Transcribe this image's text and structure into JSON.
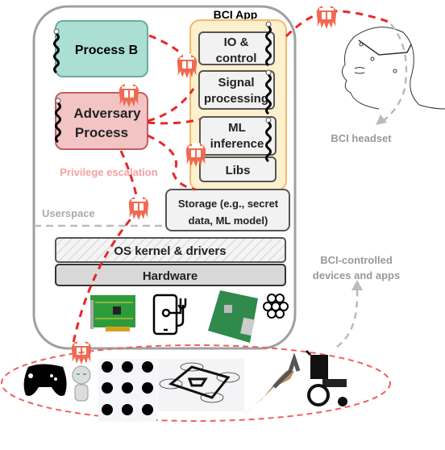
{
  "bci_app": {
    "title": "BCI App",
    "components": [
      "IO &",
      "control",
      "Signal",
      "processing",
      "ML",
      "inference",
      "Libs"
    ]
  },
  "process_b": "Process B",
  "adversary": {
    "line1": "Adversary",
    "line2": "Process"
  },
  "privilege_escalation": "Privilege escalation",
  "userspace": "Userspace",
  "storage": {
    "line1": "Storage (e.g., secret",
    "line2": "data, ML model)"
  },
  "os_kernel": "OS kernel & drivers",
  "hardware": "Hardware",
  "headset_label": "BCI headset",
  "devices_label": {
    "line1": "BCI-controlled",
    "line2": "devices and apps"
  },
  "colors": {
    "attack": "#e8272a",
    "attacker_icon": "#f06a52",
    "process_b_fill": "#acdfd4",
    "adversary_fill": "#f2c4c4",
    "bci_app_fill": "#fdf0cc",
    "bci_app_border": "#f5b870",
    "privilege_text": "#f5a0a0",
    "muted_text": "#999999"
  },
  "icons": [
    "attacker-icon",
    "thread-icon",
    "eeg-board-icon",
    "phone-health-icon",
    "raspberry-pi-board-icon",
    "raspberry-pi-logo-icon",
    "gamepad-icon",
    "robot-icon",
    "emotion-heads-icon",
    "drone-icon",
    "prosthetic-arm-icon",
    "wheelchair-icon",
    "head-with-headset-icon"
  ]
}
